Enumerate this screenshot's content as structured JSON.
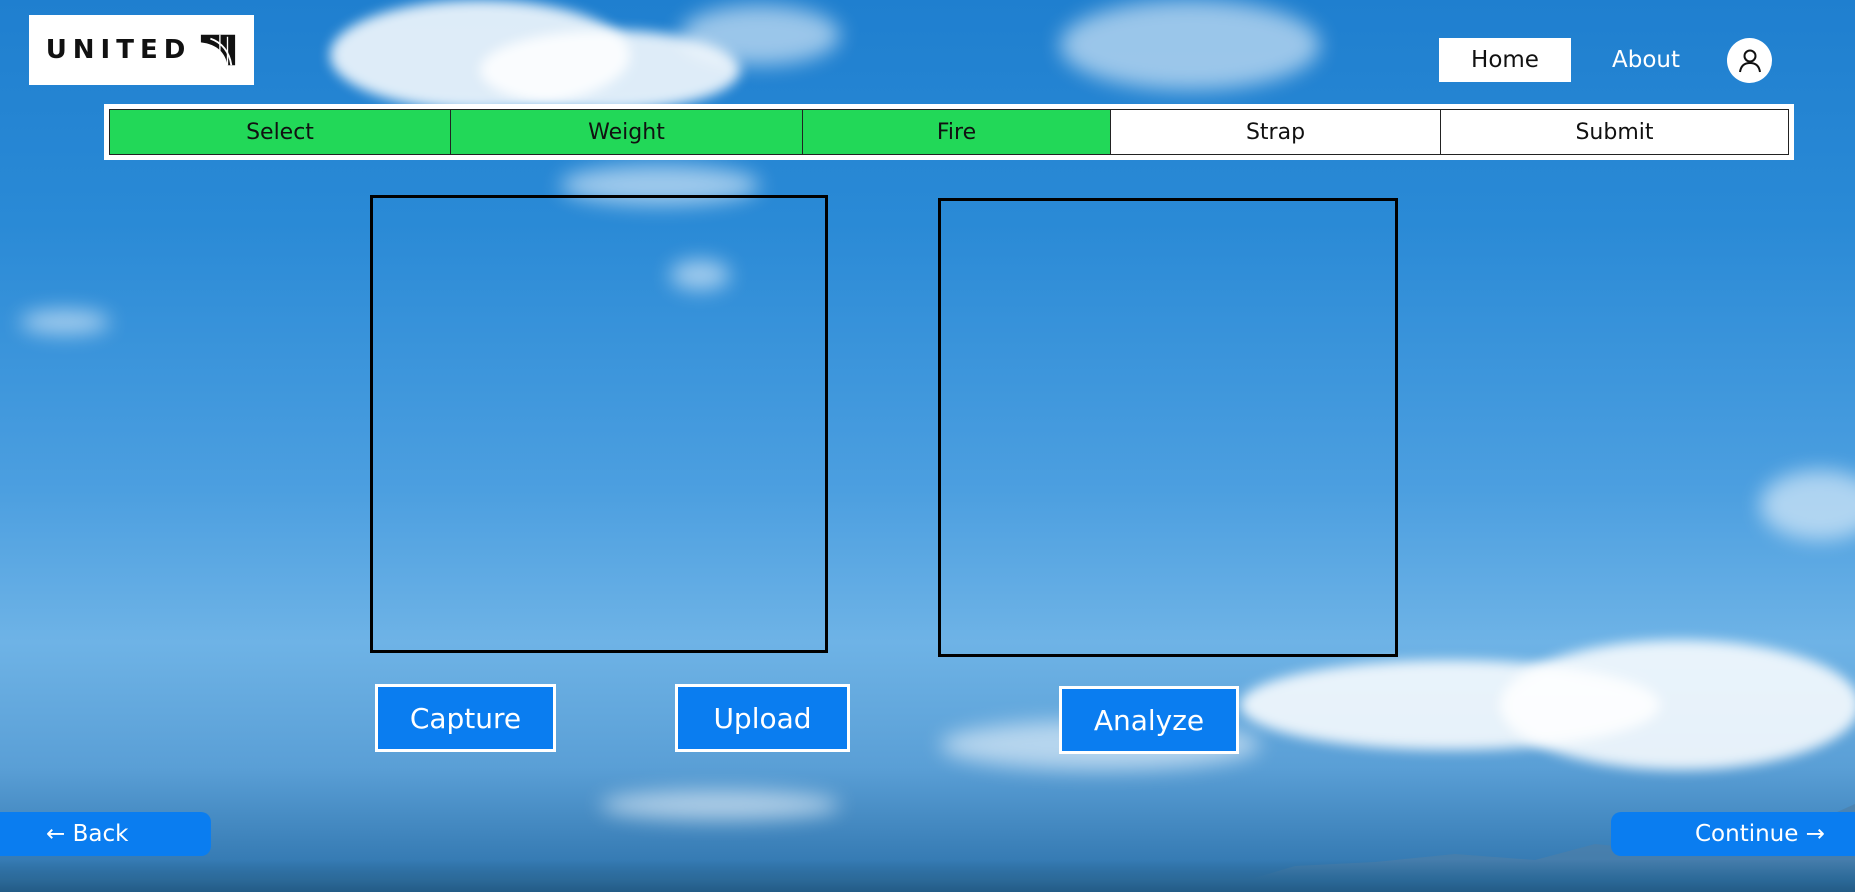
{
  "brand": {
    "logo_text": "UNITED",
    "logo_icon": "united-globe-icon"
  },
  "nav": {
    "home_label": "Home",
    "about_label": "About",
    "profile_icon": "user-icon"
  },
  "steps": [
    {
      "label": "Select",
      "status": "complete"
    },
    {
      "label": "Weight",
      "status": "complete"
    },
    {
      "label": "Fire",
      "status": "complete"
    },
    {
      "label": "Strap",
      "status": "pending"
    },
    {
      "label": "Submit",
      "status": "pending"
    }
  ],
  "actions": {
    "capture_label": "Capture",
    "upload_label": "Upload",
    "analyze_label": "Analyze"
  },
  "footer": {
    "back_label": "← Back",
    "continue_label": "Continue →"
  },
  "colors": {
    "step_complete": "#22d858",
    "step_pending": "#ffffff",
    "button_blue": "#0a7df0"
  }
}
